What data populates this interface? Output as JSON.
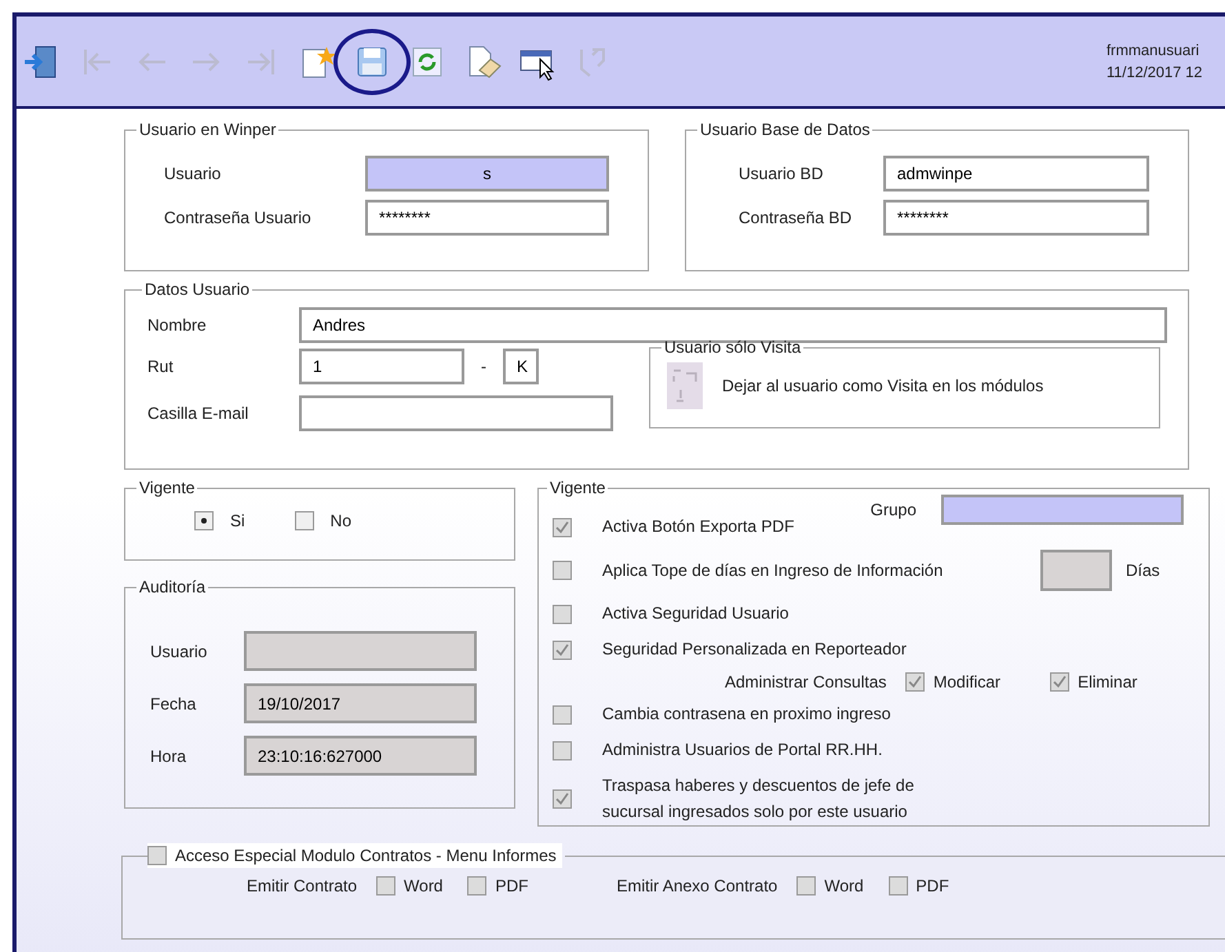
{
  "toolbar": {
    "buttons": [
      {
        "kind": "exit",
        "disabled": false,
        "highlighted": false
      },
      {
        "kind": "first",
        "disabled": true,
        "highlighted": false
      },
      {
        "kind": "previous",
        "disabled": true,
        "highlighted": false
      },
      {
        "kind": "next",
        "disabled": true,
        "highlighted": false
      },
      {
        "kind": "last",
        "disabled": true,
        "highlighted": false
      },
      {
        "kind": "new",
        "disabled": false,
        "highlighted": false
      },
      {
        "kind": "save",
        "disabled": false,
        "highlighted": true
      },
      {
        "kind": "refresh",
        "disabled": false,
        "highlighted": false
      },
      {
        "kind": "erase",
        "disabled": false,
        "highlighted": false
      },
      {
        "kind": "select",
        "disabled": false,
        "highlighted": false
      },
      {
        "kind": "undo",
        "disabled": true,
        "highlighted": false
      }
    ],
    "form_name": "frmmanusuari",
    "datetime": "11/12/2017 12"
  },
  "usuario_winper": {
    "title": "Usuario en Winper",
    "fields": [
      {
        "label": "Usuario",
        "value": "s",
        "highlighted": true
      },
      {
        "label": "Contraseña Usuario",
        "value": "********",
        "highlighted": false
      }
    ]
  },
  "usuario_bd": {
    "title": "Usuario Base de Datos",
    "fields": [
      {
        "label": "Usuario BD",
        "value": "admwinpe",
        "highlighted": false
      },
      {
        "label": "Contraseña BD",
        "value": "********",
        "highlighted": false
      }
    ]
  },
  "datos_usuario": {
    "title": "Datos Usuario",
    "nombre_label": "Nombre",
    "nombre": "Andres",
    "rut_label": "Rut",
    "rut": "1",
    "separator": "-",
    "dv": "K",
    "email_label": "Casilla E-mail",
    "visita": {
      "title": "Usuario sólo Visita",
      "text": "Dejar al usuario como Visita en los módulos"
    }
  },
  "vigente": {
    "title": "Vigente",
    "options": [
      {
        "label": "Si",
        "selected": true
      },
      {
        "label": "No",
        "selected": false
      }
    ]
  },
  "auditoria": {
    "title": "Auditoría",
    "fields": [
      {
        "label": "Usuario",
        "disabled": true
      },
      {
        "label": "Fecha",
        "value": "19/10/2017",
        "disabled": true
      },
      {
        "label": "Hora",
        "value": "23:10:16:627000",
        "disabled": true
      }
    ]
  },
  "permisos": {
    "title": "Vigente",
    "grupo_label": "Grupo",
    "grupo_highlighted": true,
    "options": [
      {
        "kind": "check",
        "label": "Activa Botón Exporta PDF",
        "checked": true
      },
      {
        "kind": "days",
        "label": "Aplica Tope de días en Ingreso de Información",
        "checked": false,
        "unit": "Días"
      },
      {
        "kind": "check",
        "label": "Activa Seguridad Usuario",
        "checked": false
      },
      {
        "kind": "check",
        "label": "Seguridad Personalizada en Reporteador",
        "checked": true
      },
      {
        "kind": "sub",
        "label": "Administrar Consultas",
        "items": [
          {
            "label": "Modificar",
            "checked": true
          },
          {
            "label": "Eliminar",
            "checked": true
          }
        ]
      },
      {
        "kind": "check",
        "label": "Cambia contrasena en proximo ingreso",
        "checked": false
      },
      {
        "kind": "check",
        "label": "Administra Usuarios de Portal RR.HH.",
        "checked": false
      },
      {
        "kind": "check",
        "label": "Traspasa haberes y descuentos de jefe de sucursal ingresados solo por este usuario",
        "checked": true
      }
    ]
  },
  "contratos": {
    "title": "Acceso Especial Modulo Contratos - Menu Informes",
    "checked": false,
    "groups": [
      {
        "label": "Emitir Contrato",
        "items": [
          {
            "label": "Word",
            "checked": false
          },
          {
            "label": "PDF",
            "checked": false
          }
        ]
      },
      {
        "label": "Emitir Anexo Contrato",
        "items": [
          {
            "label": "Word",
            "checked": false
          },
          {
            "label": "PDF",
            "checked": false
          }
        ]
      }
    ]
  }
}
